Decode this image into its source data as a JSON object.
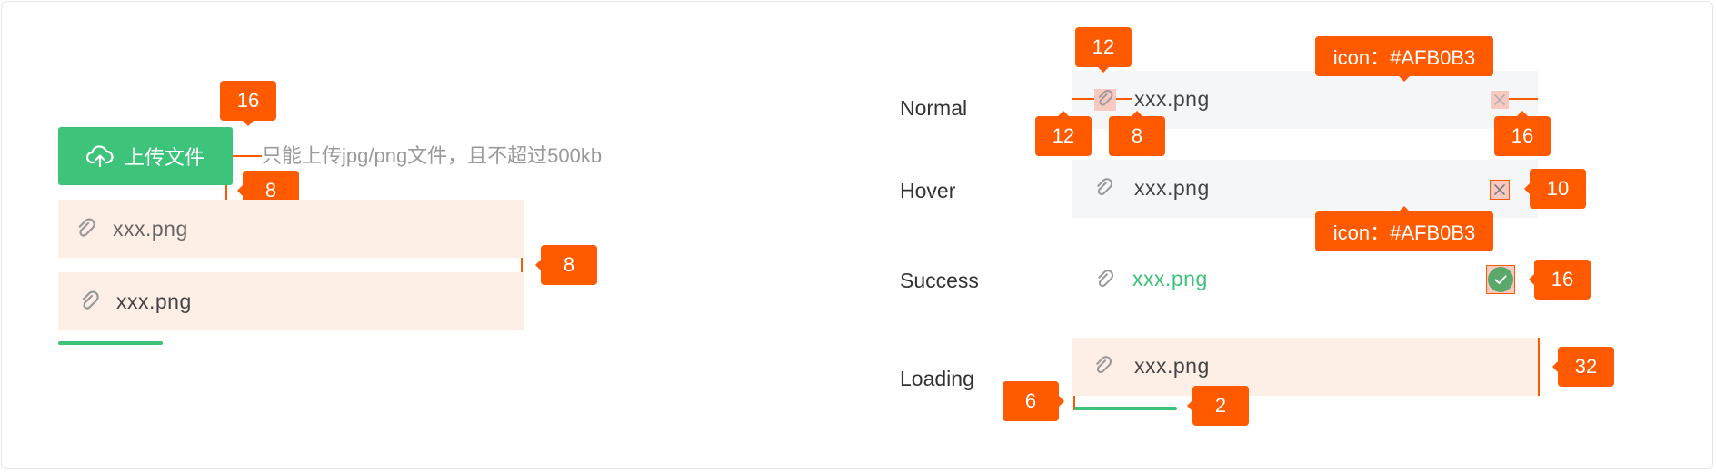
{
  "left_demo": {
    "upload_button": {
      "label": "上传文件",
      "icon": "cloud-upload-icon"
    },
    "hint": "只能上传jpg/png文件，且不超过500kb",
    "files": [
      {
        "name": "xxx.png"
      },
      {
        "name": "xxx.png"
      }
    ],
    "upload_progress": 0.25,
    "annotations": {
      "button_to_hint": "16",
      "button_to_list": "8",
      "item_gap": "8"
    }
  },
  "states": {
    "normal": {
      "label": "Normal",
      "file": "xxx.png"
    },
    "hover": {
      "label": "Hover",
      "file": "xxx.png"
    },
    "success": {
      "label": "Success",
      "file": "xxx.png"
    },
    "loading": {
      "label": "Loading",
      "file": "xxx.png",
      "progress": 0.22
    }
  },
  "annotations": {
    "normal_top": "12",
    "normal_icon_left": "12",
    "normal_icon_gap": "8",
    "normal_close_color": "icon：#AFB0B3",
    "normal_close_size": "16",
    "hover_close_size": "10",
    "hover_close_color": "icon：#AFB0B3",
    "success_icon_size": "16",
    "loading_height": "32",
    "loading_progress_left": "6",
    "loading_progress_height": "2"
  },
  "colors": {
    "primary": "#3dc37a",
    "annotation": "#ff5a00",
    "file_bg": "#fdeee6",
    "hover_bg": "#f5f6f8",
    "icon": "#AFB0B3"
  }
}
